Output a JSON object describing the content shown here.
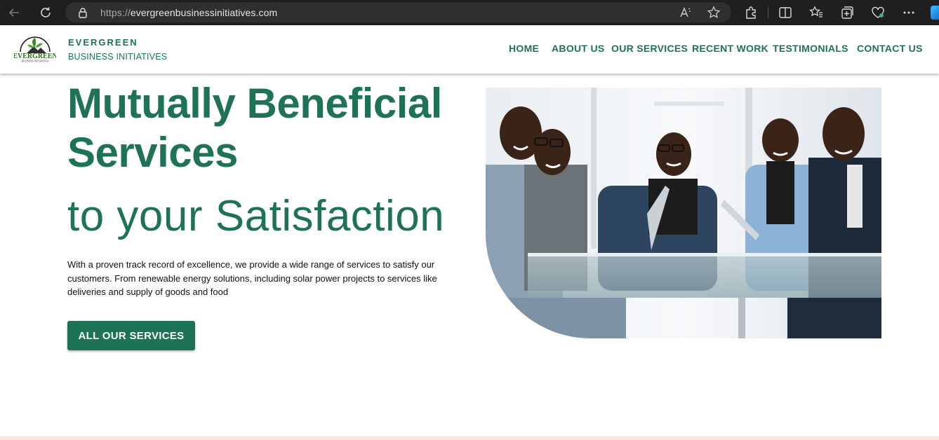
{
  "browser": {
    "url_protocol": "https://",
    "url_host": "evergreenbusinessinitiatives.com"
  },
  "header": {
    "brand_name": "EVERGREEN",
    "brand_subtitle": "BUSINESS INITIATIVES",
    "logo_text": "EVERGREEN",
    "logo_subtext": "BUSINESS INITIATIVES",
    "nav": [
      {
        "label": "HOME"
      },
      {
        "label": "ABOUT US"
      },
      {
        "label": "OUR SERVICES"
      },
      {
        "label": "RECENT WORK"
      },
      {
        "label": "TESTIMONIALS"
      },
      {
        "label": "CONTACT US"
      }
    ]
  },
  "hero": {
    "title_line1": "Mutually Beneficial",
    "title_line2": "Services",
    "subtitle": "to your Satisfaction",
    "description": "With a proven track record of excellence, we provide a wide range of services to satisfy our customers. From renewable energy solutions, including solar power projects to services like deliveries and supply of goods and food",
    "cta_label": "ALL OUR SERVICES"
  },
  "colors": {
    "brand_green": "#1e7354",
    "chrome_dark": "#1f1f1f",
    "footer_accent": "#fde4df"
  }
}
